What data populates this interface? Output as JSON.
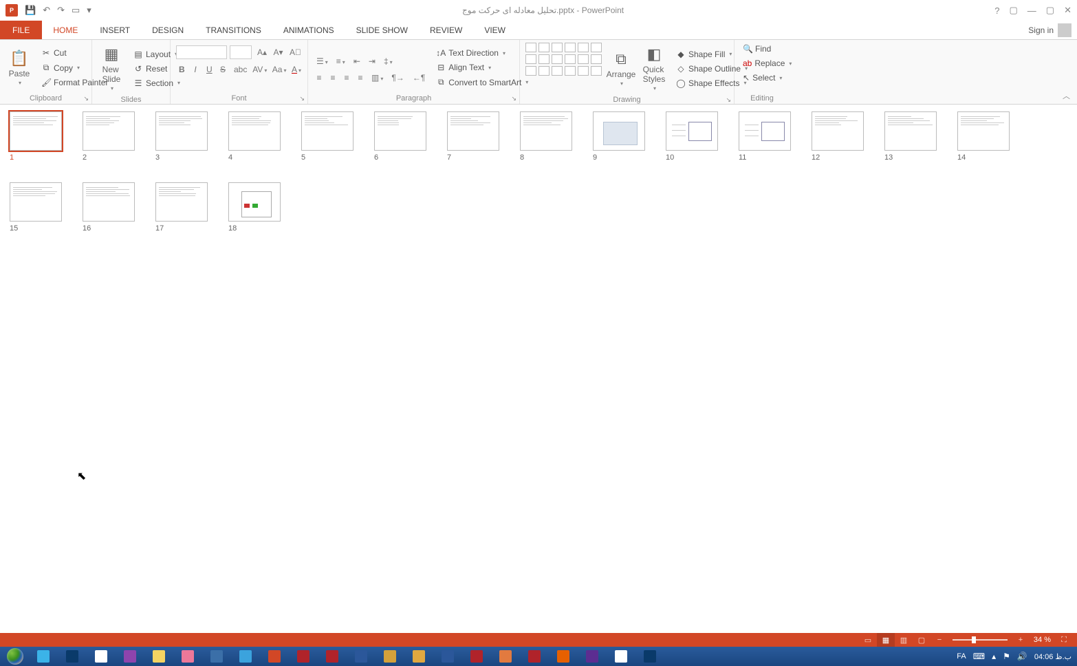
{
  "title": "تحلیل معادله ای حرکت موج.pptx - PowerPoint",
  "signin_label": "Sign in",
  "tabs": {
    "file": "FILE",
    "items": [
      "HOME",
      "INSERT",
      "DESIGN",
      "TRANSITIONS",
      "ANIMATIONS",
      "SLIDE SHOW",
      "REVIEW",
      "VIEW"
    ],
    "active": 0
  },
  "ribbon": {
    "clipboard": {
      "label": "Clipboard",
      "paste": "Paste",
      "cut": "Cut",
      "copy": "Copy",
      "format_painter": "Format Painter"
    },
    "slides": {
      "label": "Slides",
      "new_slide": "New\nSlide",
      "layout": "Layout",
      "reset": "Reset",
      "section": "Section"
    },
    "font": {
      "label": "Font"
    },
    "paragraph": {
      "label": "Paragraph",
      "text_direction": "Text Direction",
      "align_text": "Align Text",
      "convert_smartart": "Convert to SmartArt"
    },
    "drawing": {
      "label": "Drawing",
      "arrange": "Arrange",
      "quick_styles": "Quick\nStyles",
      "shape_fill": "Shape Fill",
      "shape_outline": "Shape Outline",
      "shape_effects": "Shape Effects"
    },
    "editing": {
      "label": "Editing",
      "find": "Find",
      "replace": "Replace",
      "select": "Select"
    }
  },
  "slides": [
    1,
    2,
    3,
    4,
    5,
    6,
    7,
    8,
    9,
    10,
    11,
    12,
    13,
    14,
    15,
    16,
    17,
    18
  ],
  "selected_slide": 1,
  "status": {
    "zoom_label": "34 %"
  },
  "tray": {
    "lang": "FA",
    "time": "ب.ظ 04:06"
  },
  "taskbar_apps": [
    "ie",
    "ps",
    "np",
    "sn",
    "fe",
    "mg",
    "gl",
    "tg",
    "pp",
    "fr",
    "ar",
    "ed",
    "pn",
    "sr",
    "wd",
    "ac",
    "sm",
    "br",
    "ff",
    "vs",
    "ch",
    "ps2"
  ]
}
